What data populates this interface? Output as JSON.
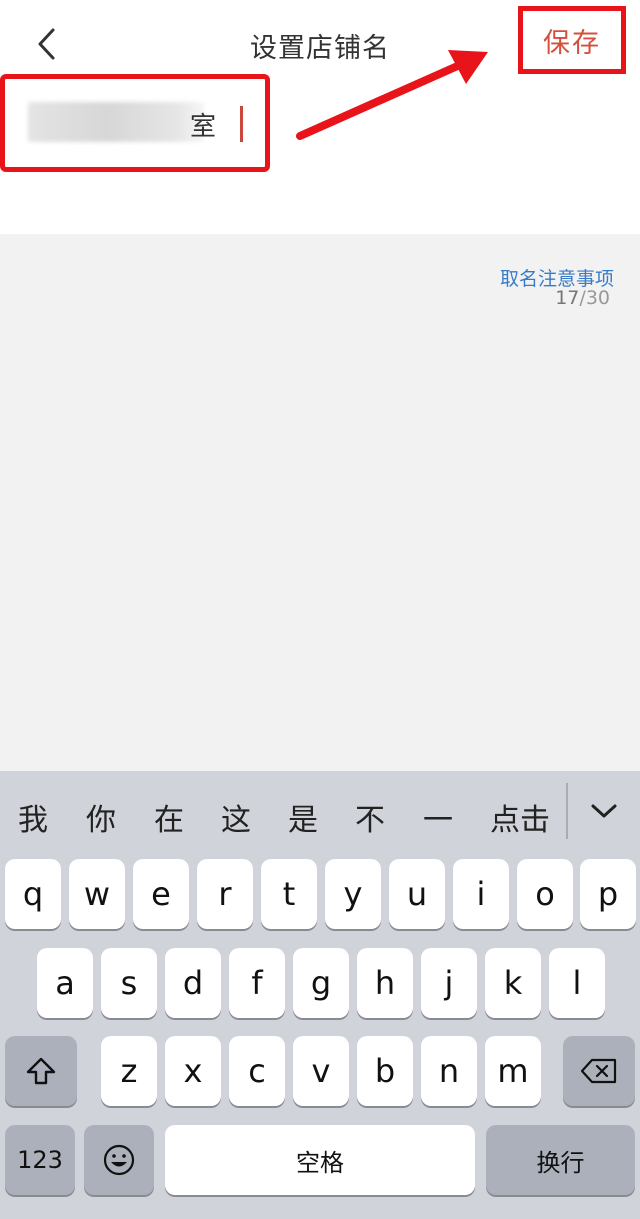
{
  "nav": {
    "back_icon": "chevron-left-icon",
    "title": "设置店铺名",
    "save_label": "保存"
  },
  "shop_name": {
    "visible_text": "室",
    "blurred": true
  },
  "counter": {
    "current": "17",
    "separator": "/",
    "max": "30"
  },
  "tips_link": "取名注意事项",
  "colors": {
    "accent": "#d64f3c",
    "annotation_red": "#e8141a",
    "link_blue": "#3a7bc8"
  },
  "keyboard": {
    "candidates": [
      "我",
      "你",
      "在",
      "这",
      "是",
      "不",
      "一",
      "点击"
    ],
    "collapse_icon": "chevron-down-icon",
    "row1": [
      "q",
      "w",
      "e",
      "r",
      "t",
      "y",
      "u",
      "i",
      "o",
      "p"
    ],
    "row2": [
      "a",
      "s",
      "d",
      "f",
      "g",
      "h",
      "j",
      "k",
      "l"
    ],
    "row3": [
      "z",
      "x",
      "c",
      "v",
      "b",
      "n",
      "m"
    ],
    "shift_icon": "shift-icon",
    "delete_icon": "backspace-icon",
    "numbers_label": "123",
    "emoji_icon": "emoji-icon",
    "space_label": "空格",
    "return_label": "换行"
  }
}
